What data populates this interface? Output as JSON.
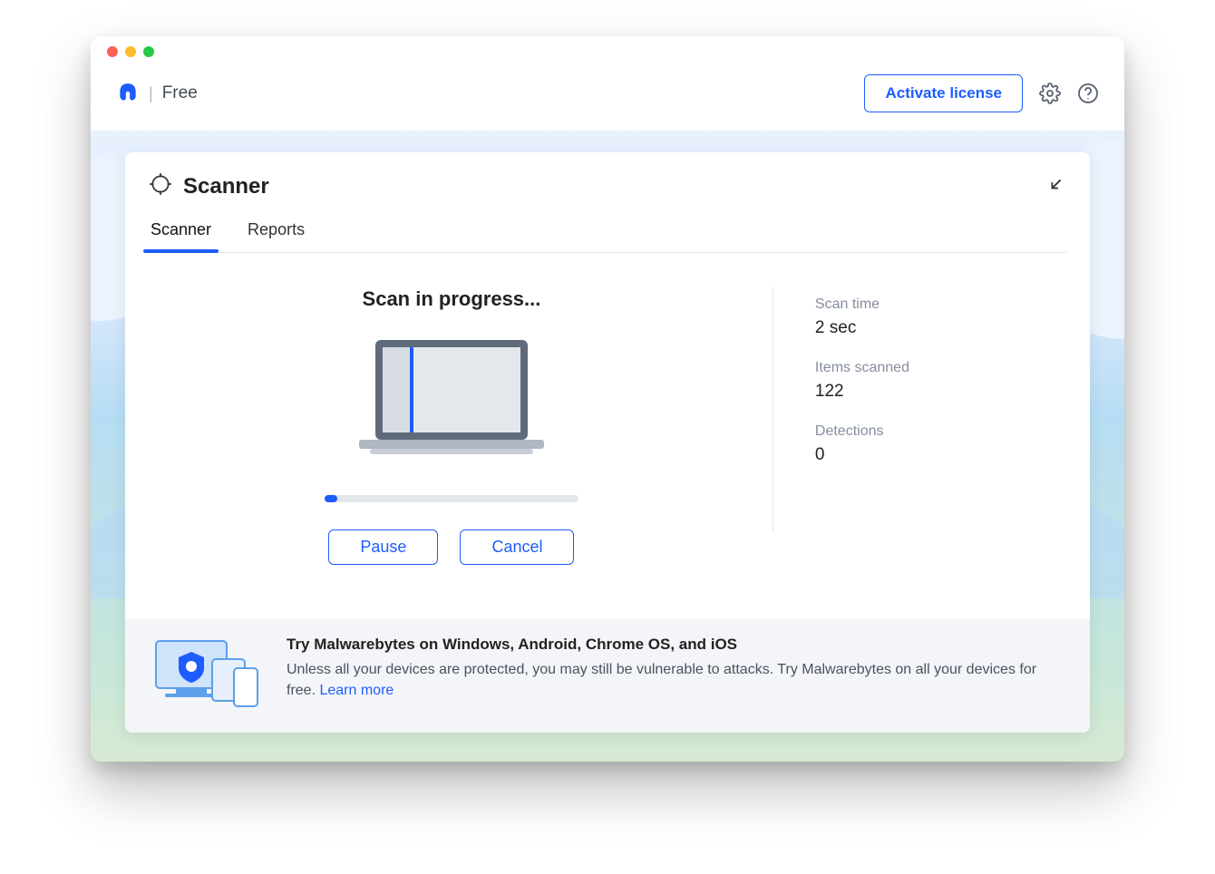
{
  "header": {
    "edition": "Free",
    "activate_label": "Activate license"
  },
  "card": {
    "title": "Scanner",
    "tabs": {
      "scanner": "Scanner",
      "reports": "Reports"
    }
  },
  "scan": {
    "heading": "Scan in progress...",
    "pause_label": "Pause",
    "cancel_label": "Cancel",
    "progress_percent": 5
  },
  "stats": {
    "time_label": "Scan time",
    "time_value": "2 sec",
    "items_label": "Items scanned",
    "items_value": "122",
    "detections_label": "Detections",
    "detections_value": "0"
  },
  "promo": {
    "title": "Try Malwarebytes on Windows, Android, Chrome OS, and iOS",
    "body": "Unless all your devices are protected, you may still be vulnerable to attacks. Try Malwarebytes on all your devices for free. ",
    "link": "Learn more"
  }
}
